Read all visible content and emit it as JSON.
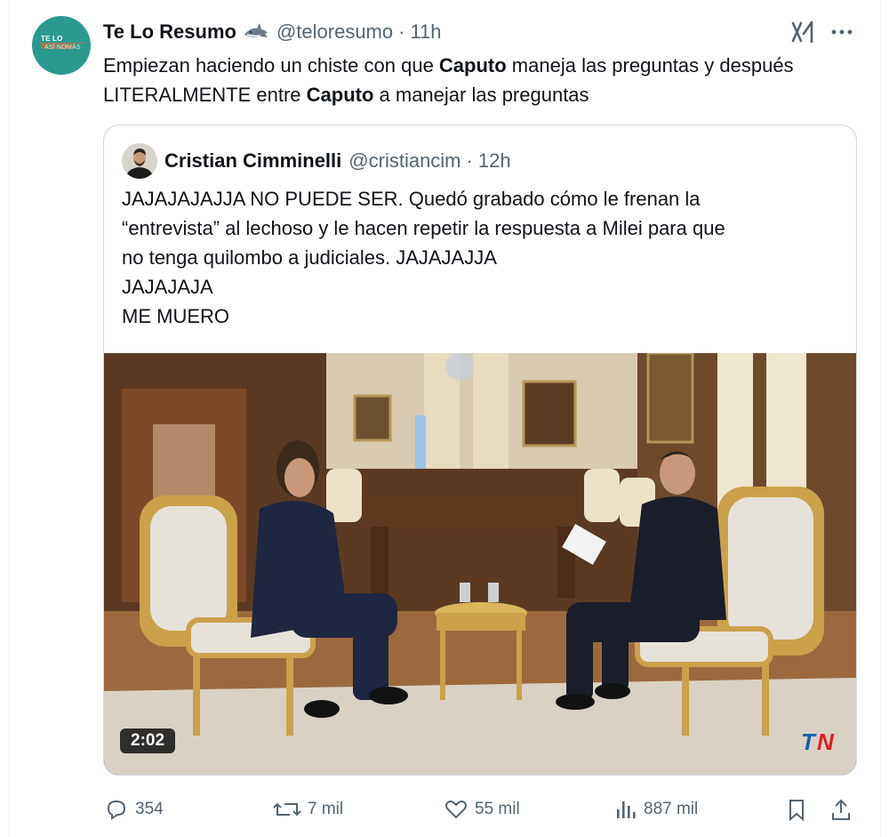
{
  "author": {
    "name": "Te Lo Resumo",
    "handle": "@teloresumo",
    "separator": "·",
    "time": "11h",
    "badge_icon": "shark-emoji",
    "avatar_text_line1_a": "TE LO",
    "avatar_text_line1_b": "RESUMO",
    "avatar_text_line2": "ASÍ NOMÁS"
  },
  "tweet": {
    "part1": "Empiezan haciendo un chiste con que ",
    "bold1": "Caputo",
    "part2": " maneja las preguntas y después LITERALMENTE entre ",
    "bold2": "Caputo",
    "part3": " a manejar las preguntas"
  },
  "quoted": {
    "name": "Cristian Cimminelli",
    "handle": "@cristiancim",
    "separator": "·",
    "time": "12h",
    "lines": [
      "JAJAJAJAJJA NO PUEDE SER. Quedó grabado cómo le frenan la",
      "“entrevista” al lechoso y le hacen repetir la respuesta a Milei para que",
      "no tenga quilombo a judiciales. JAJAJAJJA",
      "JAJAJAJA",
      "ME MUERO"
    ],
    "video": {
      "duration": "2:02",
      "watermark": "TN"
    }
  },
  "actions": {
    "replies": "354",
    "reposts": "7 mil",
    "likes": "55 mil",
    "views": "887 mil"
  },
  "icons": {
    "grok": "grok-icon",
    "more": "more-icon",
    "reply": "reply-icon",
    "repost": "repost-icon",
    "like": "like-icon",
    "views": "views-icon",
    "bookmark": "bookmark-icon",
    "share": "share-icon"
  },
  "colors": {
    "text": "#0f1419",
    "muted": "#536471",
    "border": "#cfd9de",
    "avatar_bg": "#2a9a8e",
    "tn_blue": "#1a5fb4",
    "tn_red": "#e01b24"
  }
}
